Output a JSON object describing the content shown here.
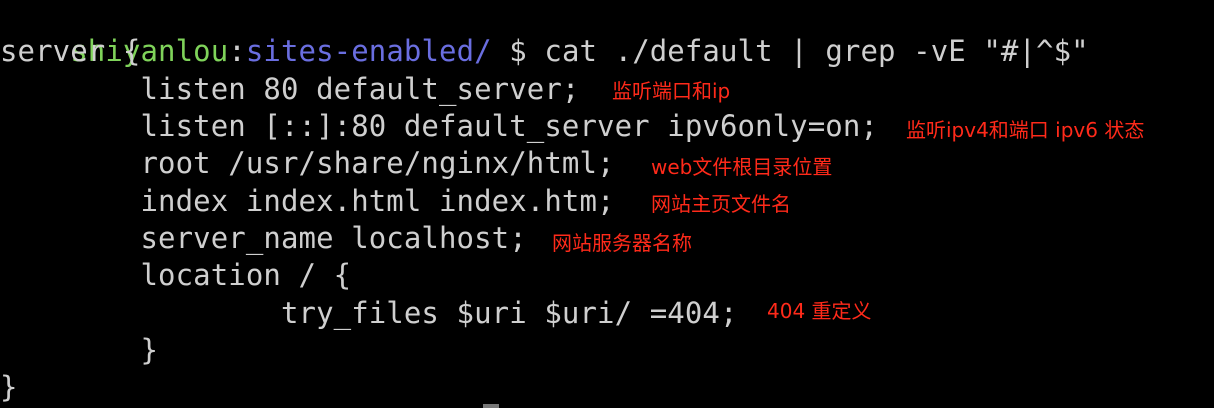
{
  "terminal": {
    "prompt": {
      "user": "shiyanlou",
      "separator": ":",
      "path": "sites-enabled/",
      "symbol": " $ ",
      "command": "cat ./default | grep -vE \"#|^$\""
    },
    "lines": [
      "server {",
      "        listen 80 default_server;",
      "        listen [::]:80 default_server ipv6only=on;",
      "        root /usr/share/nginx/html;",
      "        index index.html index.htm;",
      "        server_name localhost;",
      "        location / {",
      "                try_files $uri $uri/ =404;",
      "        }",
      "}"
    ],
    "annotations": [
      "监听端口和ip",
      "监听ipv4和端口 ipv6 状态",
      "web文件根目录位置",
      "网站主页文件名",
      "网站服务器名称",
      "404 重定义"
    ],
    "colors": {
      "background": "#000000",
      "text": "#cfcfcf",
      "user": "#7fd35a",
      "path": "#6a6ee0",
      "annotation": "#ff2a1a"
    }
  }
}
